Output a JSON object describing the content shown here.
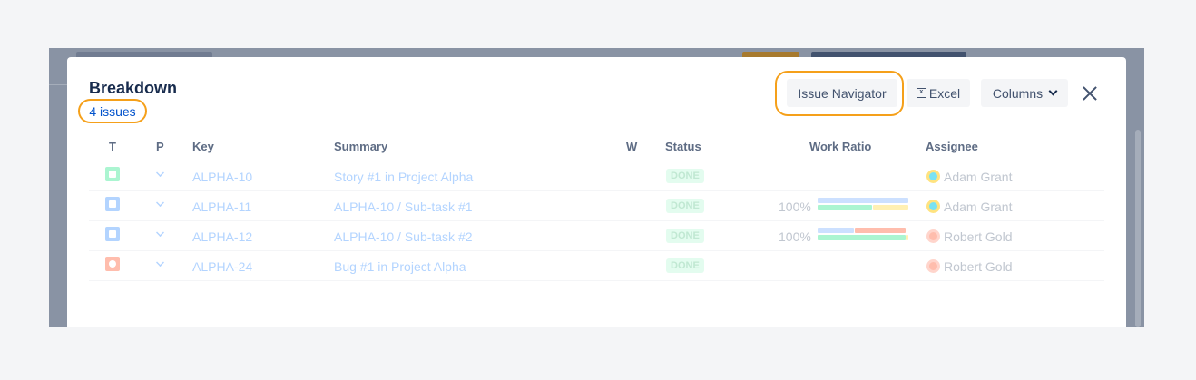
{
  "modal": {
    "title": "Breakdown",
    "issues_count": "4 issues",
    "buttons": {
      "issue_navigator": "Issue Navigator",
      "excel": "Excel",
      "columns": "Columns"
    }
  },
  "table": {
    "headers": {
      "type": "T",
      "priority": "P",
      "key": "Key",
      "summary": "Summary",
      "w": "W",
      "status": "Status",
      "work_ratio": "Work Ratio",
      "assignee": "Assignee"
    },
    "rows": [
      {
        "type_icon": "story-icon",
        "key": "ALPHA-10",
        "summary": "Story #1 in Project Alpha",
        "status": "DONE",
        "work_ratio": "",
        "assignee": "Adam Grant"
      },
      {
        "type_icon": "subtask-icon",
        "key": "ALPHA-11",
        "summary": "ALPHA-10 /  Sub-task #1",
        "status": "DONE",
        "work_ratio": "100%",
        "assignee": "Adam Grant"
      },
      {
        "type_icon": "subtask-icon",
        "key": "ALPHA-12",
        "summary": "ALPHA-10 /  Sub-task #2",
        "status": "DONE",
        "work_ratio": "100%",
        "assignee": "Robert Gold"
      },
      {
        "type_icon": "bug-icon",
        "key": "ALPHA-24",
        "summary": "Bug #1 in Project Alpha",
        "status": "DONE",
        "work_ratio": "",
        "assignee": "Robert Gold"
      }
    ]
  },
  "colors": {
    "highlight_ring": "#f5a01a",
    "link": "#0052cc",
    "bar_estimate": "#cce0ff",
    "bar_logged": "#abf5d1",
    "bar_remaining": "#fff0b3",
    "bar_over": "#ffbdad"
  }
}
